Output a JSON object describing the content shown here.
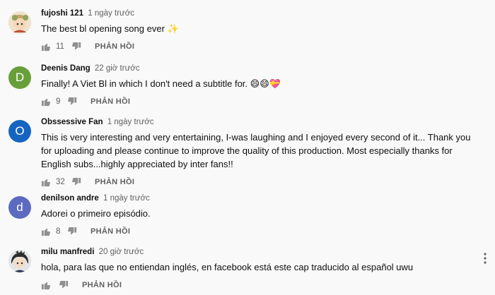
{
  "comments": [
    {
      "author": "fujoshi 121",
      "time": "1 ngày trước",
      "text": "The best bl opening song ever ✨",
      "likes": "11",
      "reply_label": "PHẢN HỒI",
      "avatar": {
        "type": "image",
        "icon": "anime-character-avatar",
        "color": "#e0c9a6"
      }
    },
    {
      "author": "Deenis Dang",
      "time": "22 giờ trước",
      "text": "Finally! A Viet Bl in which I don't need a subtitle for. 😄😄💝",
      "likes": "9",
      "reply_label": "PHẢN HỒI",
      "avatar": {
        "type": "letter",
        "letter": "D",
        "color": "#689f38"
      }
    },
    {
      "author": "Obssessive Fan",
      "time": "1 ngày trước",
      "text": "This is very interesting and very entertaining, I-was laughing and I enjoyed every second of it... Thank you for uploading and please continue to improve the quality of this production. Most especially thanks for English subs...highly appreciated by inter fans!!",
      "likes": "32",
      "reply_label": "PHẢN HỒI",
      "avatar": {
        "type": "letter",
        "letter": "O",
        "color": "#1565c0"
      }
    },
    {
      "author": "denilson andre",
      "time": "1 ngày trước",
      "text": "Adorei o primeiro episódio.",
      "likes": "8",
      "reply_label": "PHẢN HỒI",
      "avatar": {
        "type": "letter",
        "letter": "d",
        "color": "#5c6bc0"
      }
    },
    {
      "author": "milu manfredi",
      "time": "20 giờ trước",
      "text": "hola, para las que no entiendan inglés, en facebook está este cap traducido al español uwu",
      "likes": "",
      "reply_label": "PHẢN HỒI",
      "avatar": {
        "type": "image",
        "icon": "anime-character-avatar",
        "color": "#3a3a3a"
      }
    }
  ],
  "colors": {
    "background": "#f9f9f9",
    "meta_text": "#606060",
    "icon": "#909090"
  }
}
